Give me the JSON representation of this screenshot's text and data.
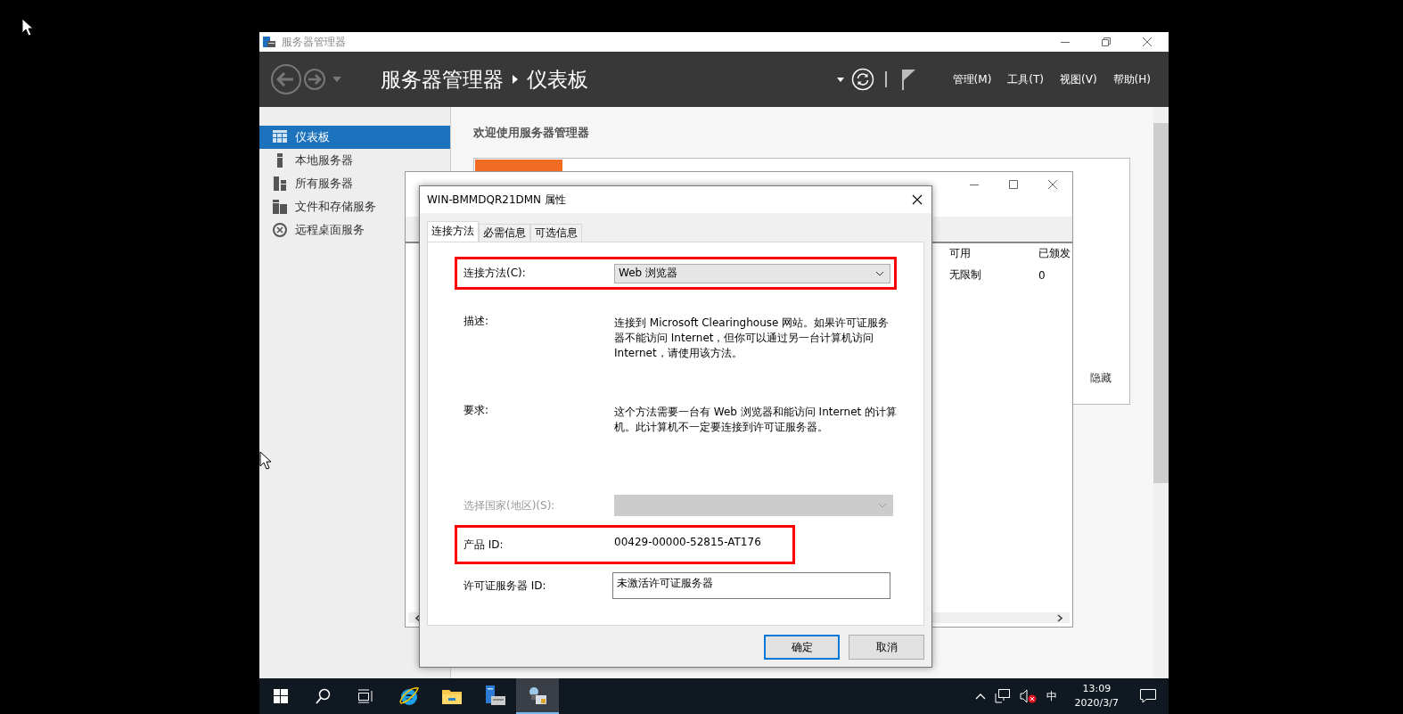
{
  "server_manager": {
    "title": "服务器管理器",
    "breadcrumb": [
      "服务器管理器",
      "仪表板"
    ],
    "menus": [
      "管理(M)",
      "工具(T)",
      "视图(V)",
      "帮助(H)"
    ],
    "sidebar": {
      "items": [
        {
          "label": "仪表板",
          "kind": "dashboard",
          "selected": true
        },
        {
          "label": "本地服务器",
          "kind": "server",
          "selected": false
        },
        {
          "label": "所有服务器",
          "kind": "servers",
          "selected": false
        },
        {
          "label": "文件和存储服务",
          "kind": "storage",
          "selected": false
        },
        {
          "label": "远程桌面服务",
          "kind": "remote",
          "selected": false
        }
      ]
    },
    "welcome": {
      "title": "欢迎使用服务器管理器",
      "hide": "隐藏"
    }
  },
  "rd_window": {
    "columns": [
      "可用",
      "已颁发"
    ],
    "rows": [
      [
        "无限制",
        "0"
      ]
    ]
  },
  "dialog": {
    "title": "WIN-BMMDQR21DMN 属性",
    "tabs": [
      {
        "label": "连接方法",
        "selected": true
      },
      {
        "label": "必需信息",
        "selected": false
      },
      {
        "label": "可选信息",
        "selected": false
      }
    ],
    "fields": [
      {
        "kind": "dropdown",
        "label": "连接方法(C):",
        "value": "Web 浏览器",
        "highlighted": true,
        "disabled": false
      },
      {
        "kind": "info",
        "label": "描述:",
        "value": "连接到 Microsoft Clearinghouse 网站。如果许可证服务器不能访问 Internet，但你可以通过另一台计算机访问 Internet，请使用该方法。",
        "highlighted": false
      },
      {
        "kind": "info",
        "label": "要求:",
        "value": "这个方法需要一台有 Web 浏览器和能访问 Internet 的计算机。此计算机不一定要连接到许可证服务器。",
        "highlighted": false
      },
      {
        "kind": "dropdown",
        "label": "选择国家(地区)(S):",
        "highlighted": false,
        "disabled": true
      },
      {
        "kind": "value",
        "label": "产品 ID:",
        "value": "00429-00000-52815-AT176",
        "highlighted": true
      },
      {
        "kind": "text",
        "label": "许可证服务器 ID:",
        "value": "未激活许可证服务器",
        "highlighted": false
      }
    ],
    "buttons": [
      {
        "label": "确定",
        "default": true
      },
      {
        "label": "取消",
        "default": false
      }
    ]
  },
  "taskbar": {
    "apps": [
      {
        "kind": "start",
        "active": false
      },
      {
        "kind": "search",
        "active": false
      },
      {
        "kind": "taskview",
        "active": false
      },
      {
        "kind": "ie",
        "active": false
      },
      {
        "kind": "explorer",
        "active": false
      },
      {
        "kind": "servermanager",
        "active": false
      },
      {
        "kind": "licensing",
        "active": true
      }
    ],
    "tray": {
      "ime": "中",
      "time": "13:09",
      "date": "2020/3/7"
    }
  }
}
